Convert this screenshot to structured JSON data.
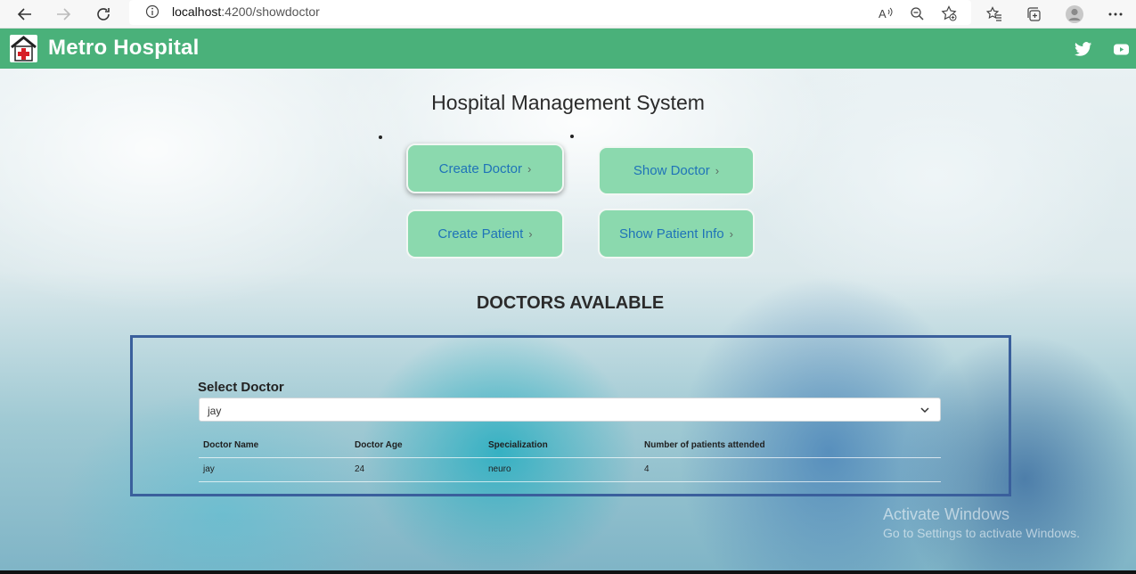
{
  "browser": {
    "url_host": "localhost",
    "url_rest": ":4200/showdoctor"
  },
  "header": {
    "brand": "Metro Hospital",
    "social": [
      "twitter-icon",
      "youtube-icon"
    ],
    "color": "#4ab17a"
  },
  "page": {
    "title": "Hospital Management System"
  },
  "buttons": [
    {
      "label": "Create Doctor"
    },
    {
      "label": "Show Doctor"
    },
    {
      "label": "Create Patient"
    },
    {
      "label": "Show Patient Info"
    }
  ],
  "doctors": {
    "section_title": "DOCTORS AVALABLE",
    "select_label": "Select Doctor",
    "selected": "jay",
    "columns": [
      "Doctor Name",
      "Doctor Age",
      "Specialization",
      "Number of patients attended"
    ],
    "rows": [
      [
        "jay",
        "24",
        "neuro",
        "4"
      ]
    ]
  },
  "watermark": {
    "line1": "Activate Windows",
    "line2": "Go to Settings to activate Windows."
  },
  "colors": {
    "button_bg": "#8bd9ae",
    "button_text": "#1f73b8",
    "panel_border": "#3a5f9c"
  }
}
